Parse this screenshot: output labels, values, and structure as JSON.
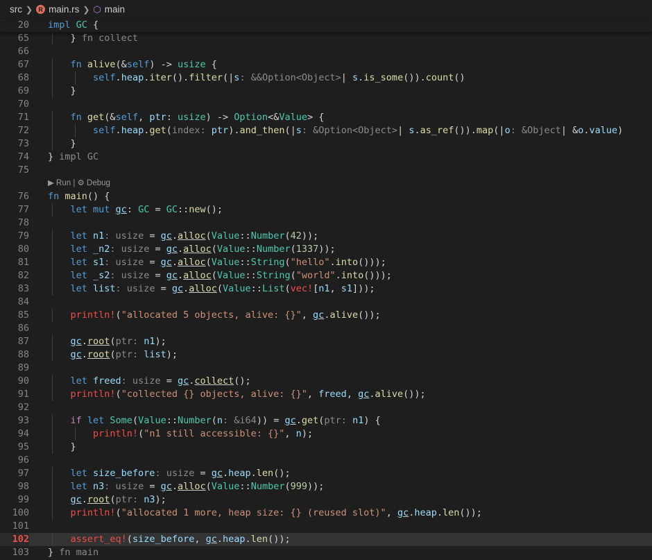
{
  "breadcrumb": {
    "folder": "src",
    "file": "main.rs",
    "symbol": "main"
  },
  "sticky": {
    "line_number": "20",
    "text": "impl GC {"
  },
  "codelens": {
    "run": "Run",
    "separator": "|",
    "debug": "Debug"
  },
  "active_line": "102",
  "lines": [
    {
      "num": "65",
      "tokens": [
        [
          "4",
          ""
        ],
        [
          "} ",
          ""
        ],
        [
          "fn collect",
          "c"
        ]
      ]
    },
    {
      "num": "66",
      "tokens": []
    },
    {
      "num": "67",
      "tokens": [
        [
          "4",
          ""
        ],
        [
          "fn ",
          "k"
        ],
        [
          "alive",
          "f"
        ],
        [
          "(&",
          ""
        ],
        [
          "self",
          "k"
        ],
        [
          ") -> ",
          ""
        ],
        [
          "usize",
          "t"
        ],
        [
          " {",
          ""
        ]
      ]
    },
    {
      "num": "68",
      "tokens": [
        [
          "8",
          ""
        ],
        [
          "self",
          "k"
        ],
        [
          ".",
          ""
        ],
        [
          "heap",
          "v"
        ],
        [
          ".",
          ""
        ],
        [
          "iter",
          "f"
        ],
        [
          "().",
          ""
        ],
        [
          "filter",
          "f"
        ],
        [
          "(|",
          ""
        ],
        [
          "s",
          "v"
        ],
        [
          ": &&Option<Object>",
          "h"
        ],
        [
          "| ",
          ""
        ],
        [
          "s",
          "v"
        ],
        [
          ".",
          ""
        ],
        [
          "is_some",
          "f"
        ],
        [
          "()).",
          ""
        ],
        [
          "count",
          "f"
        ],
        [
          "()",
          ""
        ]
      ]
    },
    {
      "num": "69",
      "tokens": [
        [
          "4",
          ""
        ],
        [
          "}",
          ""
        ]
      ]
    },
    {
      "num": "70",
      "tokens": []
    },
    {
      "num": "71",
      "tokens": [
        [
          "4",
          ""
        ],
        [
          "fn ",
          "k"
        ],
        [
          "get",
          "f"
        ],
        [
          "(&",
          ""
        ],
        [
          "self",
          "k"
        ],
        [
          ", ",
          ""
        ],
        [
          "ptr",
          "v"
        ],
        [
          ": ",
          ""
        ],
        [
          "usize",
          "t"
        ],
        [
          ") -> ",
          ""
        ],
        [
          "Option",
          "t"
        ],
        [
          "<&",
          ""
        ],
        [
          "Value",
          "t"
        ],
        [
          "> {",
          ""
        ]
      ]
    },
    {
      "num": "72",
      "tokens": [
        [
          "8",
          ""
        ],
        [
          "self",
          "k"
        ],
        [
          ".",
          ""
        ],
        [
          "heap",
          "v"
        ],
        [
          ".",
          ""
        ],
        [
          "get",
          "f"
        ],
        [
          "(",
          ""
        ],
        [
          "index:",
          "h"
        ],
        [
          " ",
          ""
        ],
        [
          "ptr",
          "v"
        ],
        [
          ").",
          ""
        ],
        [
          "and_then",
          "f"
        ],
        [
          "(|",
          ""
        ],
        [
          "s",
          "v"
        ],
        [
          ": &Option<Object>",
          "h"
        ],
        [
          "| ",
          ""
        ],
        [
          "s",
          "v"
        ],
        [
          ".",
          ""
        ],
        [
          "as_ref",
          "f"
        ],
        [
          "()).",
          ""
        ],
        [
          "map",
          "f"
        ],
        [
          "(|",
          ""
        ],
        [
          "o",
          "v"
        ],
        [
          ": &Object",
          "h"
        ],
        [
          "| &",
          ""
        ],
        [
          "o",
          "v"
        ],
        [
          ".",
          ""
        ],
        [
          "value",
          "v"
        ],
        [
          ")",
          ""
        ]
      ]
    },
    {
      "num": "73",
      "tokens": [
        [
          "4",
          ""
        ],
        [
          "}",
          ""
        ]
      ]
    },
    {
      "num": "74",
      "tokens": [
        [
          "0",
          ""
        ],
        [
          "} ",
          ""
        ],
        [
          "impl GC",
          "c"
        ]
      ]
    },
    {
      "num": "75",
      "tokens": []
    },
    {
      "num": "lens",
      "tokens": []
    },
    {
      "num": "76",
      "tokens": [
        [
          "0",
          ""
        ],
        [
          "fn ",
          "k"
        ],
        [
          "main",
          "f"
        ],
        [
          "() {",
          ""
        ]
      ]
    },
    {
      "num": "77",
      "tokens": [
        [
          "4",
          ""
        ],
        [
          "let mut ",
          "k"
        ],
        [
          "gc",
          "vu"
        ],
        [
          ": ",
          ""
        ],
        [
          "GC",
          "t"
        ],
        [
          " = ",
          ""
        ],
        [
          "GC",
          "t"
        ],
        [
          "::",
          ""
        ],
        [
          "new",
          "f"
        ],
        [
          "();",
          ""
        ]
      ]
    },
    {
      "num": "78",
      "tokens": []
    },
    {
      "num": "79",
      "tokens": [
        [
          "4",
          ""
        ],
        [
          "let ",
          "k"
        ],
        [
          "n1",
          "v"
        ],
        [
          ": usize",
          "h"
        ],
        [
          " = ",
          ""
        ],
        [
          "gc",
          "vu"
        ],
        [
          ".",
          ""
        ],
        [
          "alloc",
          "fu"
        ],
        [
          "(",
          ""
        ],
        [
          "Value",
          "t"
        ],
        [
          "::",
          ""
        ],
        [
          "Number",
          "t"
        ],
        [
          "(",
          ""
        ],
        [
          "42",
          "n"
        ],
        [
          "));",
          ""
        ]
      ]
    },
    {
      "num": "80",
      "tokens": [
        [
          "4",
          ""
        ],
        [
          "let ",
          "k"
        ],
        [
          "_n2",
          "v"
        ],
        [
          ": usize",
          "h"
        ],
        [
          " = ",
          ""
        ],
        [
          "gc",
          "vu"
        ],
        [
          ".",
          ""
        ],
        [
          "alloc",
          "fu"
        ],
        [
          "(",
          ""
        ],
        [
          "Value",
          "t"
        ],
        [
          "::",
          ""
        ],
        [
          "Number",
          "t"
        ],
        [
          "(",
          ""
        ],
        [
          "1337",
          "n"
        ],
        [
          "));",
          ""
        ]
      ]
    },
    {
      "num": "81",
      "tokens": [
        [
          "4",
          ""
        ],
        [
          "let ",
          "k"
        ],
        [
          "s1",
          "v"
        ],
        [
          ": usize",
          "h"
        ],
        [
          " = ",
          ""
        ],
        [
          "gc",
          "vu"
        ],
        [
          ".",
          ""
        ],
        [
          "alloc",
          "fu"
        ],
        [
          "(",
          ""
        ],
        [
          "Value",
          "t"
        ],
        [
          "::",
          ""
        ],
        [
          "String",
          "t"
        ],
        [
          "(",
          ""
        ],
        [
          "\"hello\"",
          "s"
        ],
        [
          ".",
          ""
        ],
        [
          "into",
          "f"
        ],
        [
          "()));",
          ""
        ]
      ]
    },
    {
      "num": "82",
      "tokens": [
        [
          "4",
          ""
        ],
        [
          "let ",
          "k"
        ],
        [
          "_s2",
          "v"
        ],
        [
          ": usize",
          "h"
        ],
        [
          " = ",
          ""
        ],
        [
          "gc",
          "vu"
        ],
        [
          ".",
          ""
        ],
        [
          "alloc",
          "fu"
        ],
        [
          "(",
          ""
        ],
        [
          "Value",
          "t"
        ],
        [
          "::",
          ""
        ],
        [
          "String",
          "t"
        ],
        [
          "(",
          ""
        ],
        [
          "\"world\"",
          "s"
        ],
        [
          ".",
          ""
        ],
        [
          "into",
          "f"
        ],
        [
          "()));",
          ""
        ]
      ]
    },
    {
      "num": "83",
      "tokens": [
        [
          "4",
          ""
        ],
        [
          "let ",
          "k"
        ],
        [
          "list",
          "v"
        ],
        [
          ": usize",
          "h"
        ],
        [
          " = ",
          ""
        ],
        [
          "gc",
          "vu"
        ],
        [
          ".",
          ""
        ],
        [
          "alloc",
          "fu"
        ],
        [
          "(",
          ""
        ],
        [
          "Value",
          "t"
        ],
        [
          "::",
          ""
        ],
        [
          "List",
          "t"
        ],
        [
          "(",
          ""
        ],
        [
          "vec!",
          "m"
        ],
        [
          "[",
          ""
        ],
        [
          "n1",
          "v"
        ],
        [
          ", ",
          ""
        ],
        [
          "s1",
          "v"
        ],
        [
          "]));",
          ""
        ]
      ]
    },
    {
      "num": "84",
      "tokens": []
    },
    {
      "num": "85",
      "tokens": [
        [
          "4",
          ""
        ],
        [
          "println!",
          "m"
        ],
        [
          "(",
          ""
        ],
        [
          "\"allocated 5 objects, alive: {}\"",
          "s"
        ],
        [
          ", ",
          ""
        ],
        [
          "gc",
          "vu"
        ],
        [
          ".",
          ""
        ],
        [
          "alive",
          "f"
        ],
        [
          "());",
          ""
        ]
      ]
    },
    {
      "num": "86",
      "tokens": []
    },
    {
      "num": "87",
      "tokens": [
        [
          "4",
          ""
        ],
        [
          "gc",
          "vu"
        ],
        [
          ".",
          ""
        ],
        [
          "root",
          "fu"
        ],
        [
          "(",
          ""
        ],
        [
          "ptr:",
          "h"
        ],
        [
          " ",
          ""
        ],
        [
          "n1",
          "v"
        ],
        [
          ");",
          ""
        ]
      ]
    },
    {
      "num": "88",
      "tokens": [
        [
          "4",
          ""
        ],
        [
          "gc",
          "vu"
        ],
        [
          ".",
          ""
        ],
        [
          "root",
          "fu"
        ],
        [
          "(",
          ""
        ],
        [
          "ptr:",
          "h"
        ],
        [
          " ",
          ""
        ],
        [
          "list",
          "v"
        ],
        [
          ");",
          ""
        ]
      ]
    },
    {
      "num": "89",
      "tokens": []
    },
    {
      "num": "90",
      "tokens": [
        [
          "4",
          ""
        ],
        [
          "let ",
          "k"
        ],
        [
          "freed",
          "v"
        ],
        [
          ": usize",
          "h"
        ],
        [
          " = ",
          ""
        ],
        [
          "gc",
          "vu"
        ],
        [
          ".",
          ""
        ],
        [
          "collect",
          "fu"
        ],
        [
          "();",
          ""
        ]
      ]
    },
    {
      "num": "91",
      "tokens": [
        [
          "4",
          ""
        ],
        [
          "println!",
          "m"
        ],
        [
          "(",
          ""
        ],
        [
          "\"collected {} objects, alive: {}\"",
          "s"
        ],
        [
          ", ",
          ""
        ],
        [
          "freed",
          "v"
        ],
        [
          ", ",
          ""
        ],
        [
          "gc",
          "vu"
        ],
        [
          ".",
          ""
        ],
        [
          "alive",
          "f"
        ],
        [
          "());",
          ""
        ]
      ]
    },
    {
      "num": "92",
      "tokens": []
    },
    {
      "num": "93",
      "tokens": [
        [
          "4",
          ""
        ],
        [
          "if ",
          "kc"
        ],
        [
          "let ",
          "k"
        ],
        [
          "Some",
          "t"
        ],
        [
          "(",
          ""
        ],
        [
          "Value",
          "t"
        ],
        [
          "::",
          ""
        ],
        [
          "Number",
          "t"
        ],
        [
          "(",
          ""
        ],
        [
          "n",
          "v"
        ],
        [
          ": &i64",
          "h"
        ],
        [
          ")) = ",
          ""
        ],
        [
          "gc",
          "vu"
        ],
        [
          ".",
          ""
        ],
        [
          "get",
          "f"
        ],
        [
          "(",
          ""
        ],
        [
          "ptr:",
          "h"
        ],
        [
          " ",
          ""
        ],
        [
          "n1",
          "v"
        ],
        [
          ") {",
          ""
        ]
      ]
    },
    {
      "num": "94",
      "tokens": [
        [
          "8",
          ""
        ],
        [
          "println!",
          "m"
        ],
        [
          "(",
          ""
        ],
        [
          "\"n1 still accessible: {}\"",
          "s"
        ],
        [
          ", ",
          ""
        ],
        [
          "n",
          "v"
        ],
        [
          ");",
          ""
        ]
      ]
    },
    {
      "num": "95",
      "tokens": [
        [
          "4",
          ""
        ],
        [
          "}",
          ""
        ]
      ]
    },
    {
      "num": "96",
      "tokens": []
    },
    {
      "num": "97",
      "tokens": [
        [
          "4",
          ""
        ],
        [
          "let ",
          "k"
        ],
        [
          "size_before",
          "v"
        ],
        [
          ": usize",
          "h"
        ],
        [
          " = ",
          ""
        ],
        [
          "gc",
          "vu"
        ],
        [
          ".",
          ""
        ],
        [
          "heap",
          "v"
        ],
        [
          ".",
          ""
        ],
        [
          "len",
          "f"
        ],
        [
          "();",
          ""
        ]
      ]
    },
    {
      "num": "98",
      "tokens": [
        [
          "4",
          ""
        ],
        [
          "let ",
          "k"
        ],
        [
          "n3",
          "v"
        ],
        [
          ": usize",
          "h"
        ],
        [
          " = ",
          ""
        ],
        [
          "gc",
          "vu"
        ],
        [
          ".",
          ""
        ],
        [
          "alloc",
          "fu"
        ],
        [
          "(",
          ""
        ],
        [
          "Value",
          "t"
        ],
        [
          "::",
          ""
        ],
        [
          "Number",
          "t"
        ],
        [
          "(",
          ""
        ],
        [
          "999",
          "n"
        ],
        [
          "));",
          ""
        ]
      ]
    },
    {
      "num": "99",
      "tokens": [
        [
          "4",
          ""
        ],
        [
          "gc",
          "vu"
        ],
        [
          ".",
          ""
        ],
        [
          "root",
          "fu"
        ],
        [
          "(",
          ""
        ],
        [
          "ptr:",
          "h"
        ],
        [
          " ",
          ""
        ],
        [
          "n3",
          "v"
        ],
        [
          ");",
          ""
        ]
      ]
    },
    {
      "num": "100",
      "tokens": [
        [
          "4",
          ""
        ],
        [
          "println!",
          "m"
        ],
        [
          "(",
          ""
        ],
        [
          "\"allocated 1 more, heap size: {} (reused slot)\"",
          "s"
        ],
        [
          ", ",
          ""
        ],
        [
          "gc",
          "vu"
        ],
        [
          ".",
          ""
        ],
        [
          "heap",
          "v"
        ],
        [
          ".",
          ""
        ],
        [
          "len",
          "f"
        ],
        [
          "());",
          ""
        ]
      ]
    },
    {
      "num": "101",
      "tokens": []
    },
    {
      "num": "102",
      "tokens": [
        [
          "4",
          ""
        ],
        [
          "assert_eq!",
          "m"
        ],
        [
          "(",
          ""
        ],
        [
          "size_before",
          "v"
        ],
        [
          ", ",
          ""
        ],
        [
          "gc",
          "vu"
        ],
        [
          ".",
          ""
        ],
        [
          "heap",
          "v"
        ],
        [
          ".",
          ""
        ],
        [
          "len",
          "f"
        ],
        [
          "());",
          ""
        ]
      ]
    },
    {
      "num": "103",
      "tokens": [
        [
          "0",
          ""
        ],
        [
          "} ",
          ""
        ],
        [
          "fn main",
          "c"
        ]
      ]
    }
  ]
}
